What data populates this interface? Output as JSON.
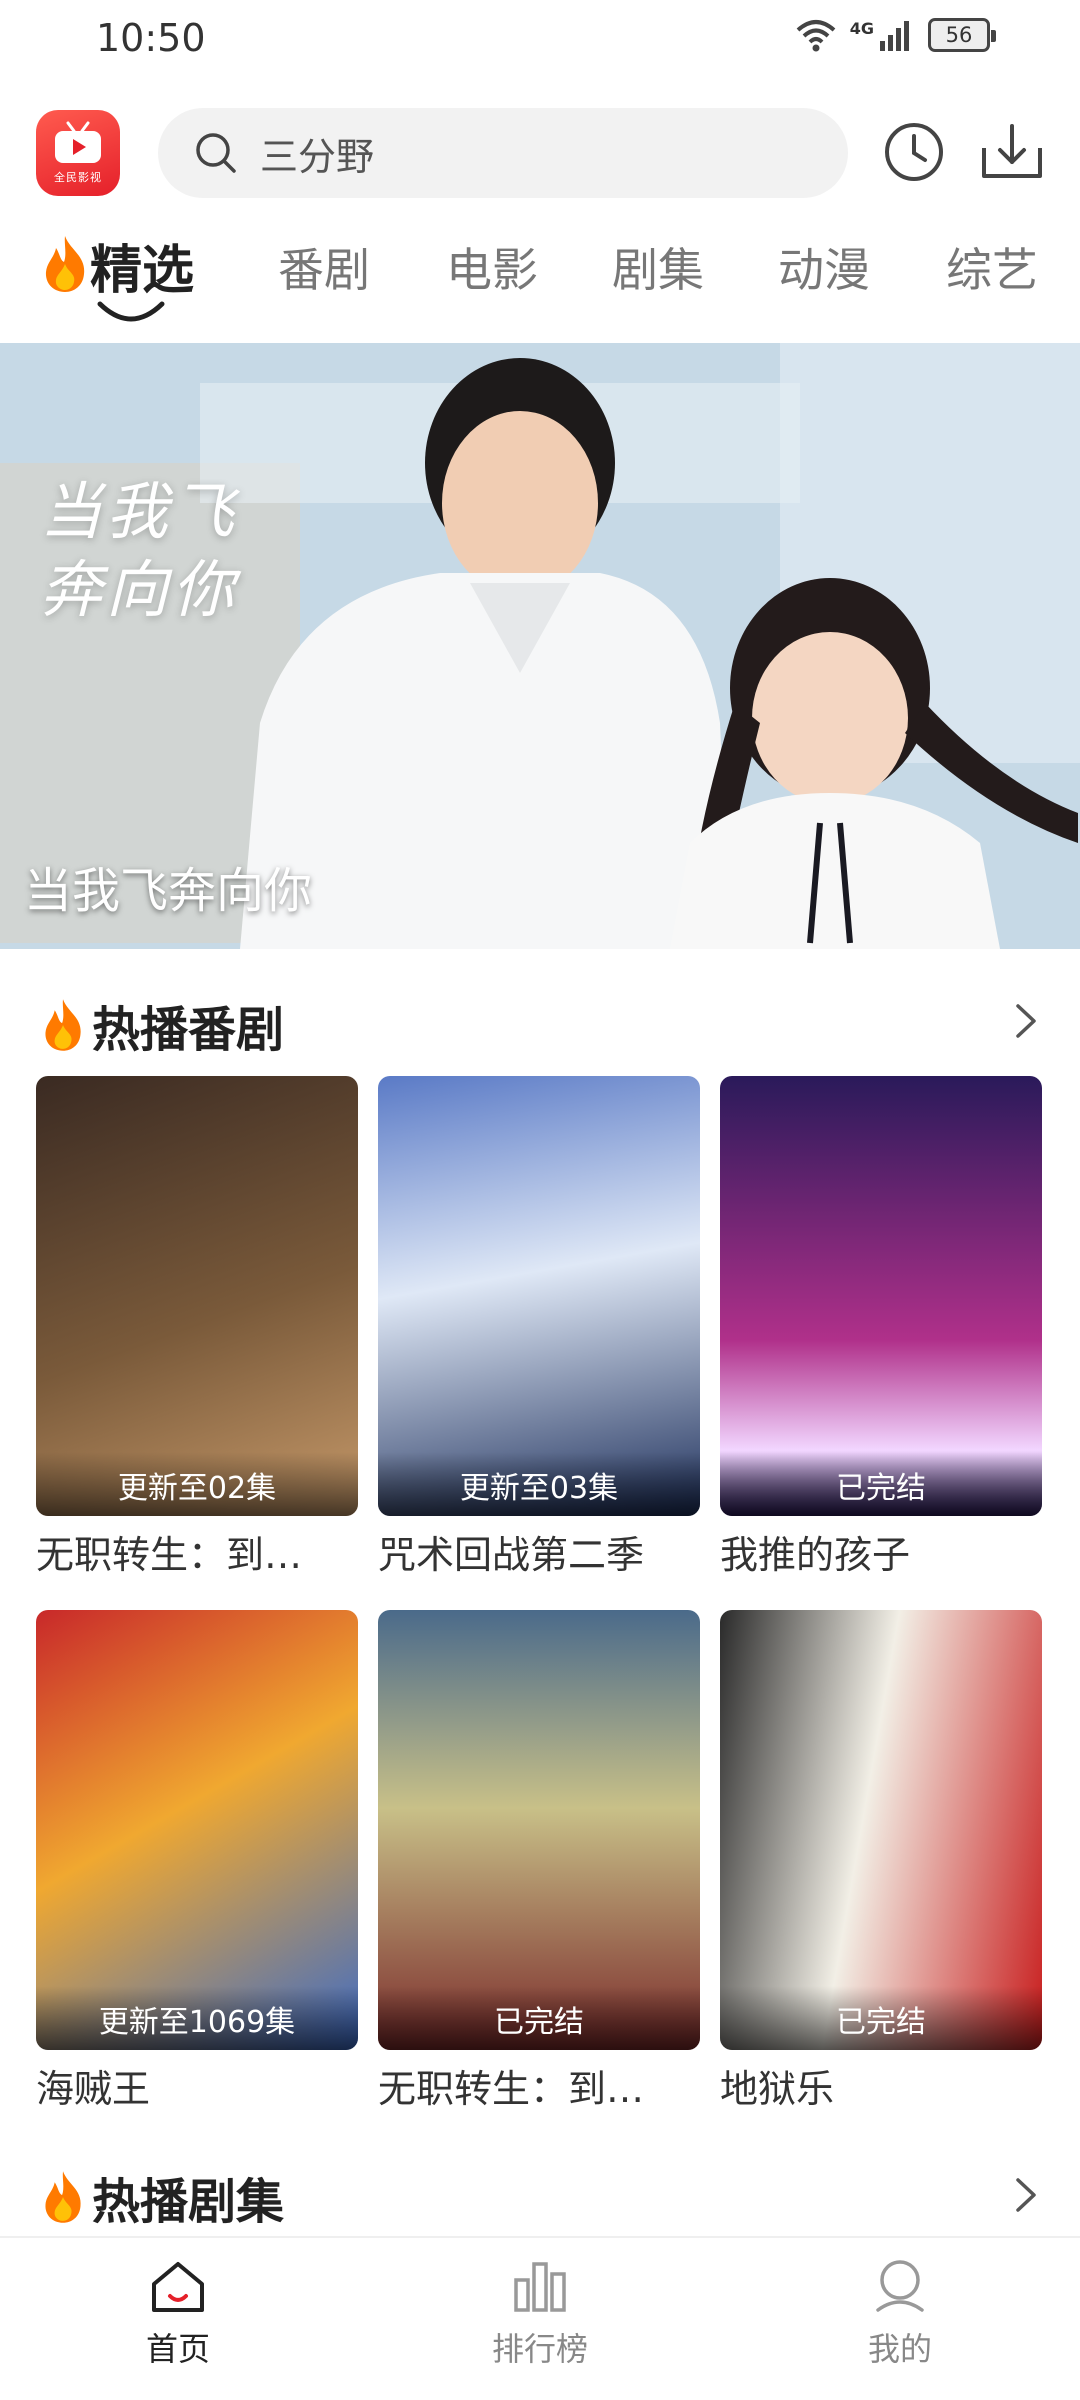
{
  "status_bar": {
    "time": "10:50",
    "network": "4G",
    "battery": "56"
  },
  "app": {
    "logo_caption": "全民影视"
  },
  "search": {
    "placeholder": "三分野"
  },
  "tabs": [
    {
      "label": "精选",
      "active": true
    },
    {
      "label": "番剧"
    },
    {
      "label": "电影"
    },
    {
      "label": "剧集"
    },
    {
      "label": "动漫"
    },
    {
      "label": "综艺"
    }
  ],
  "banner": {
    "title_art": "当我飞奔向你",
    "caption": "当我飞奔向你"
  },
  "sections": [
    {
      "title": "热播番剧",
      "items": [
        {
          "title": "无职转生：到…",
          "badge": "更新至02集",
          "colors": [
            "#3a2a22",
            "#7a5a3a",
            "#c79a6a"
          ]
        },
        {
          "title": "咒术回战第二季",
          "badge": "更新至03集",
          "colors": [
            "#1c2e5a",
            "#5a7ac6",
            "#dfe8f6"
          ]
        },
        {
          "title": "我推的孩子",
          "badge": "已完结",
          "colors": [
            "#2a1a5a",
            "#b0308a",
            "#f2d6ff"
          ]
        },
        {
          "title": "海贼王",
          "badge": "更新至1069集",
          "colors": [
            "#c8282a",
            "#f0a830",
            "#3a6ac8"
          ]
        },
        {
          "title": "无职转生：到…",
          "badge": "已完结",
          "colors": [
            "#4a6a8a",
            "#c8c088",
            "#7a2a2a"
          ]
        },
        {
          "title": "地狱乐",
          "badge": "已完结",
          "colors": [
            "#f2efe6",
            "#c81e1e",
            "#2a2a2a"
          ]
        }
      ]
    },
    {
      "title": "热播剧集"
    }
  ],
  "bottom_nav": [
    {
      "label": "首页",
      "icon": "home-icon",
      "active": true
    },
    {
      "label": "排行榜",
      "icon": "ranking-icon"
    },
    {
      "label": "我的",
      "icon": "profile-icon"
    }
  ],
  "colors": {
    "accent": "#e5202a",
    "flame": "#ff7a00"
  }
}
